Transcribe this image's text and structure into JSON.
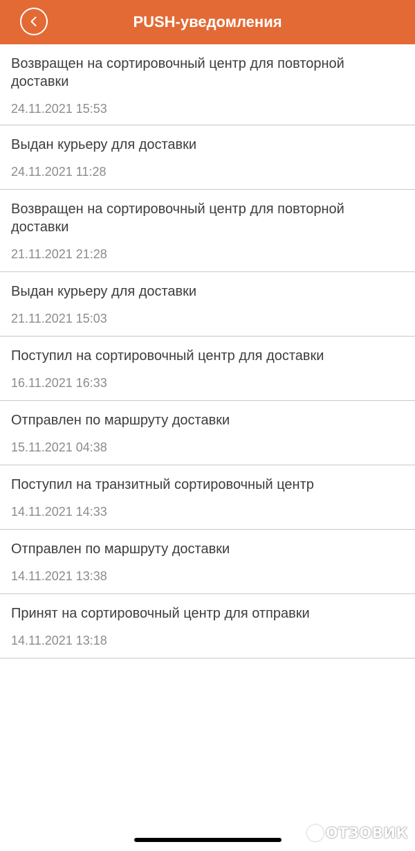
{
  "header": {
    "title": "PUSH-уведомления",
    "back_icon": "chevron-left-icon",
    "background_color": "#e36a35"
  },
  "notifications": [
    {
      "title": "Возвращен на сортировочный центр для повторной доставки",
      "time": "24.11.2021 15:53"
    },
    {
      "title": "Выдан курьеру для доставки",
      "time": "24.11.2021 11:28"
    },
    {
      "title": "Возвращен на сортировочный центр для повторной доставки",
      "time": "21.11.2021 21:28"
    },
    {
      "title": "Выдан курьеру для доставки",
      "time": "21.11.2021 15:03"
    },
    {
      "title": "Поступил на сортировочный центр для доставки",
      "time": "16.11.2021 16:33"
    },
    {
      "title": "Отправлен по маршруту доставки",
      "time": "15.11.2021 04:38"
    },
    {
      "title": "Поступил на транзитный сортировочный центр",
      "time": "14.11.2021 14:33"
    },
    {
      "title": "Отправлен по маршруту доставки",
      "time": "14.11.2021 13:38"
    },
    {
      "title": "Принят на сортировочный центр для отправки",
      "time": "14.11.2021 13:18"
    }
  ],
  "watermark": {
    "text": "ОТЗОВИК"
  }
}
